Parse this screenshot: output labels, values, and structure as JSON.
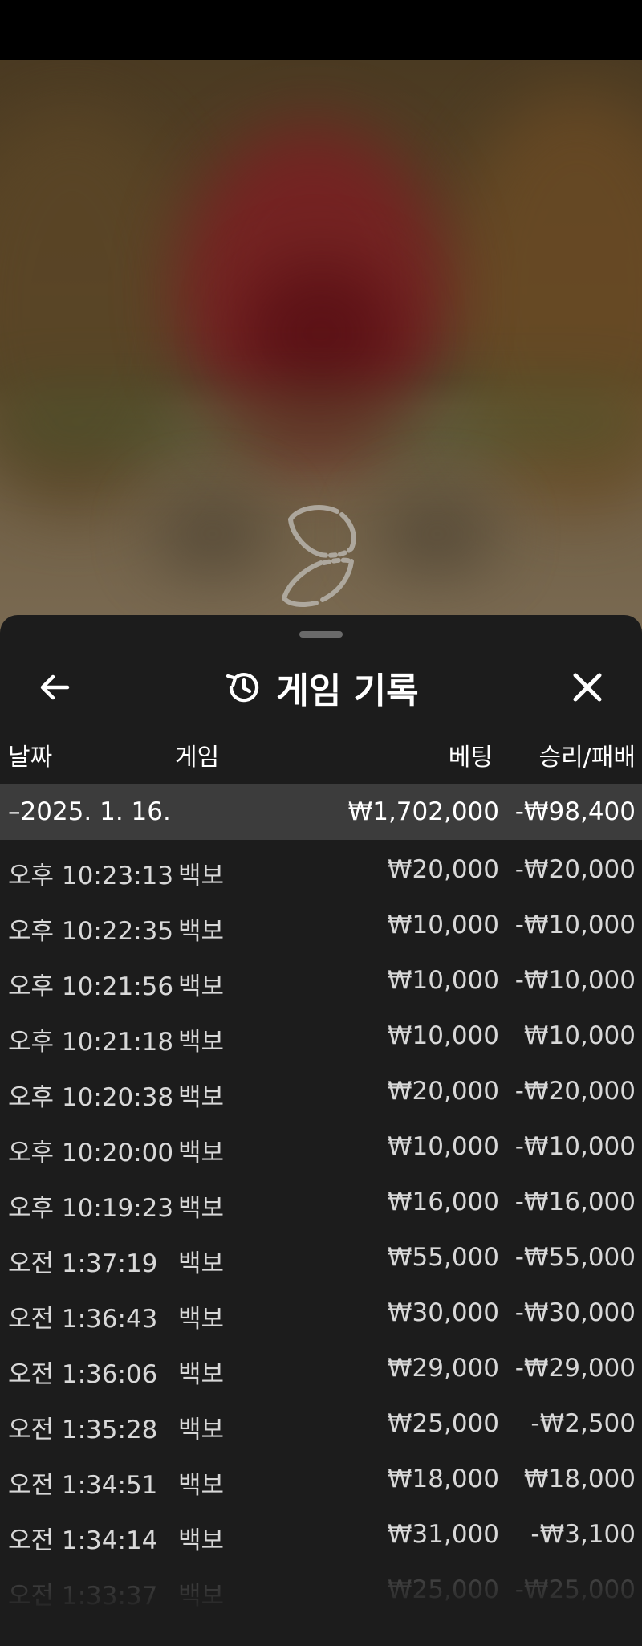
{
  "sheet": {
    "title": "게임 기록"
  },
  "columns": {
    "date": "날짜",
    "game": "게임",
    "bet": "베팅",
    "result": "승리/패배"
  },
  "date_group": {
    "label": "–2025. 1. 16.",
    "total_bet": "₩1,702,000",
    "total_result": "-₩98,400"
  },
  "rows": [
    {
      "time": "오후 10:23:13",
      "game": "백보",
      "bet": "₩20,000",
      "result": "-₩20,000"
    },
    {
      "time": "오후 10:22:35",
      "game": "백보",
      "bet": "₩10,000",
      "result": "-₩10,000"
    },
    {
      "time": "오후 10:21:56",
      "game": "백보",
      "bet": "₩10,000",
      "result": "-₩10,000"
    },
    {
      "time": "오후 10:21:18",
      "game": "백보",
      "bet": "₩10,000",
      "result": "₩10,000"
    },
    {
      "time": "오후 10:20:38",
      "game": "백보",
      "bet": "₩20,000",
      "result": "-₩20,000"
    },
    {
      "time": "오후 10:20:00",
      "game": "백보",
      "bet": "₩10,000",
      "result": "-₩10,000"
    },
    {
      "time": "오후 10:19:23",
      "game": "백보",
      "bet": "₩16,000",
      "result": "-₩16,000"
    },
    {
      "time": "오전 1:37:19",
      "game": "백보",
      "bet": "₩55,000",
      "result": "-₩55,000"
    },
    {
      "time": "오전 1:36:43",
      "game": "백보",
      "bet": "₩30,000",
      "result": "-₩30,000"
    },
    {
      "time": "오전 1:36:06",
      "game": "백보",
      "bet": "₩29,000",
      "result": "-₩29,000"
    },
    {
      "time": "오전 1:35:28",
      "game": "백보",
      "bet": "₩25,000",
      "result": "-₩2,500"
    },
    {
      "time": "오전 1:34:51",
      "game": "백보",
      "bet": "₩18,000",
      "result": "₩18,000"
    },
    {
      "time": "오전 1:34:14",
      "game": "백보",
      "bet": "₩31,000",
      "result": "-₩3,100"
    },
    {
      "time": "오전 1:33:37",
      "game": "백보",
      "bet": "₩25,000",
      "result": "-₩25,000"
    }
  ],
  "icons": {
    "back": "arrow-left-icon",
    "history": "history-icon",
    "close": "close-icon",
    "loading": "loading-spinner-icon"
  },
  "colors": {
    "sheet_bg": "#1c1c1c",
    "date_row_bg": "#3c3c3c",
    "text": "#ffffff",
    "row_text": "#d8d8d8"
  }
}
